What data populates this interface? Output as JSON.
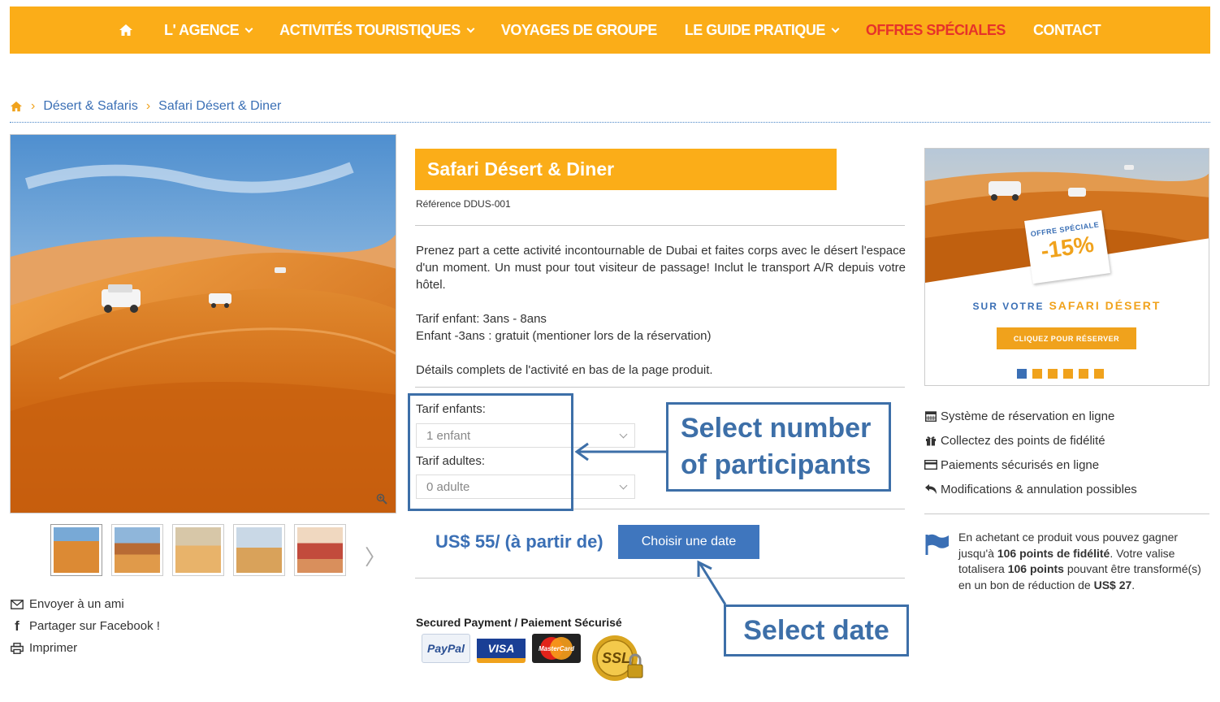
{
  "nav": {
    "items": [
      {
        "label": "L' AGENCE",
        "dropdown": true
      },
      {
        "label": "ACTIVITÉS TOURISTIQUES",
        "dropdown": true
      },
      {
        "label": "VOYAGES DE GROUPE",
        "dropdown": false
      },
      {
        "label": "LE GUIDE PRATIQUE",
        "dropdown": true
      },
      {
        "label": "OFFRES SPÉCIALES",
        "dropdown": false,
        "highlight": true
      },
      {
        "label": "CONTACT",
        "dropdown": false
      }
    ],
    "home_icon": "home-icon",
    "bg_color": "#fbad18",
    "highlight_color": "#e6332a"
  },
  "breadcrumb": {
    "items": [
      "Désert & Safaris",
      "Safari Désert & Diner"
    ]
  },
  "gallery": {
    "thumbnail_count": 5,
    "next_glyph": "〉"
  },
  "share": {
    "email": "Envoyer à un ami",
    "facebook": "Partager sur Facebook !",
    "print": "Imprimer"
  },
  "product": {
    "title": "Safari Désert & Diner",
    "reference": "Référence DDUS-001",
    "description": "Prenez part a cette activité incontournable de Dubai et faites corps avec le désert l'espace d'un moment. Un must pour tout visiteur de passage! Inclut le transport A/R depuis votre hôtel.",
    "child_rate": "Tarif enfant: 3ans - 8ans",
    "infant_rate": "Enfant -3ans : gratuit (mentioner lors de la réservation)",
    "details_note": "Détails complets de l'activité en bas de la page produit.",
    "children_label": "Tarif enfants:",
    "children_value": "1 enfant",
    "adults_label": "Tarif adultes:",
    "adults_value": "0 adulte",
    "price": "US$ 55/ (à partir de)",
    "choose_date_button": "Choisir une date",
    "secured_payment": "Secured Payment / Paiement Sécurisé",
    "payment_logos": [
      "PayPal",
      "VISA",
      "MasterCard",
      "SSL"
    ]
  },
  "annotations": {
    "participants": "Select number of participants",
    "date": "Select date"
  },
  "promo": {
    "tag": "OFFRE SPÉCIALE",
    "discount": "-15%",
    "text_prefix": "SUR VOTRE",
    "text_highlight": "SAFARI DÉSERT",
    "button": "CLIQUEZ POUR RÉSERVER",
    "slides": 6,
    "active_slide": 0
  },
  "features": [
    {
      "icon": "calendar-icon",
      "label": "Système de réservation en ligne"
    },
    {
      "icon": "gift-icon",
      "label": "Collectez des points de fidélité"
    },
    {
      "icon": "credit-card-icon",
      "label": "Paiements sécurisés en ligne"
    },
    {
      "icon": "undo-icon",
      "label": "Modifications & annulation possibles"
    }
  ],
  "loyalty": {
    "line1": "En achetant ce produit vous pouvez gagner jusqu'à",
    "points1": "106 points de fidélité",
    "line2": "Votre valise totalisera",
    "points2": "106 points",
    "line3": "pouvant être transformé(s) en un bon de réduction de",
    "amount": "US$ 27"
  }
}
